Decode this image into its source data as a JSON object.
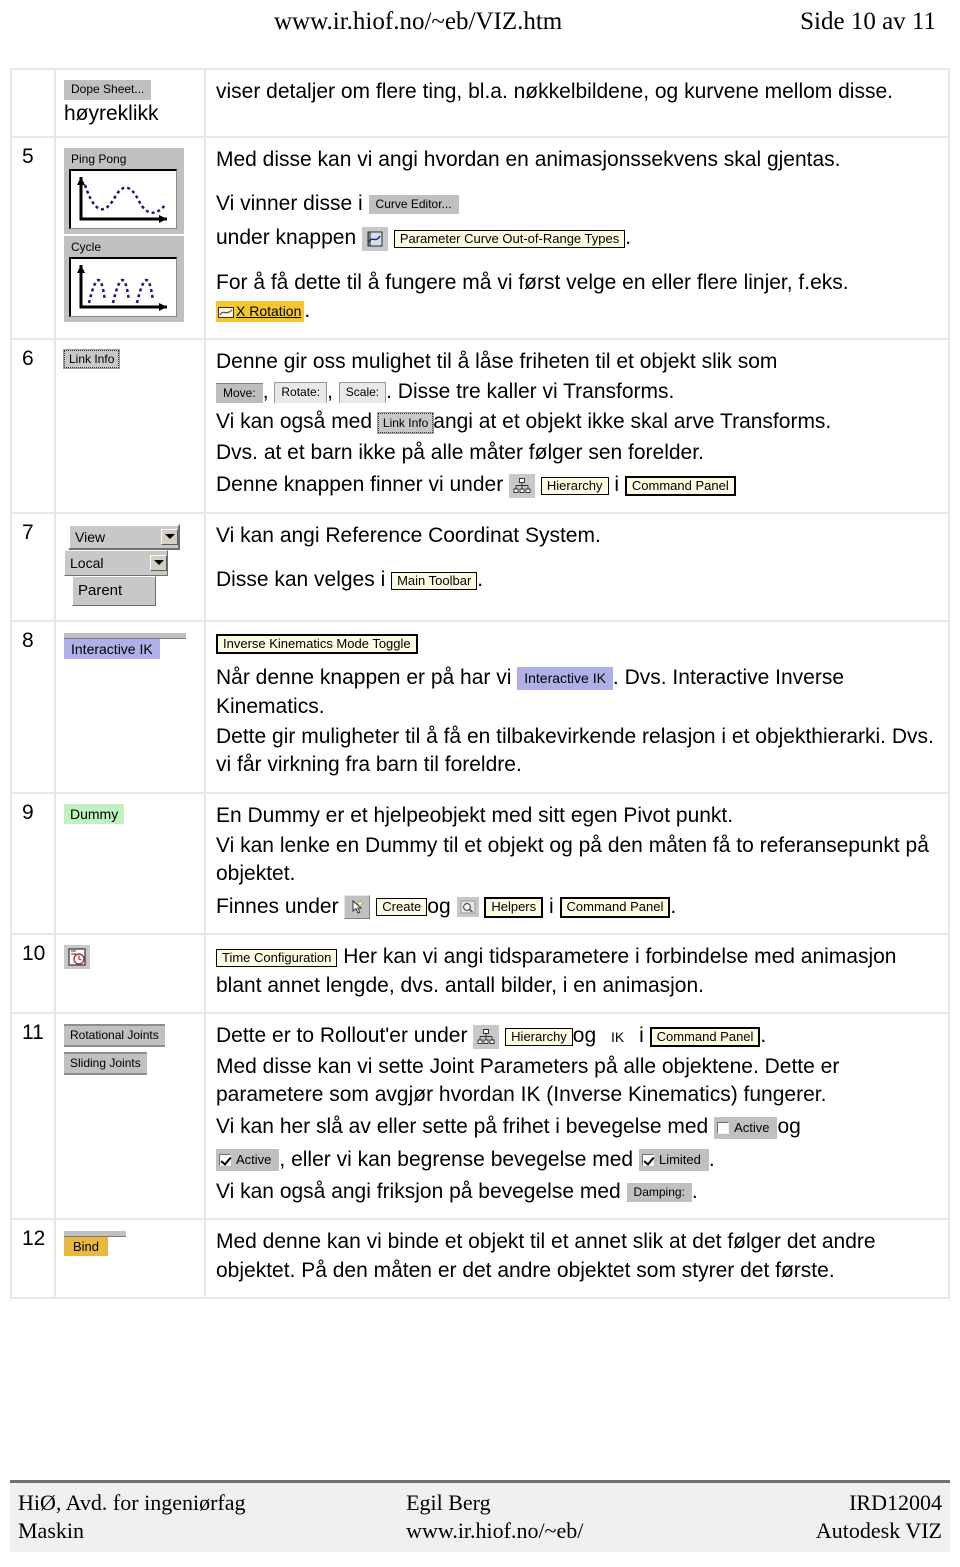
{
  "header": {
    "url": "www.ir.hiof.no/~eb/VIZ.htm",
    "page_label": "Side 10 av 11"
  },
  "rows": [
    {
      "num": "",
      "icon": {
        "button": "Dope Sheet...",
        "caption": "høyreklikk"
      },
      "paragraphs": [
        "viser detaljer om flere ting, bl.a. nøkkelbildene, og kurvene mellom disse."
      ]
    },
    {
      "num": "5",
      "icon": {
        "ping_pong": "Ping Pong",
        "cycle": "Cycle"
      },
      "text": {
        "p1": "Med disse kan vi angi hvordan en animasjonssekvens skal gjentas.",
        "p2_pre": "Vi vinner disse i",
        "curve_editor": "Curve Editor...",
        "p3_pre": "under knappen",
        "param_curve_tip": "Parameter Curve Out-of-Range Types",
        "p3_post": ".",
        "p4_pre": "For å få dette til å fungere må vi først velge en eller flere linjer, f.eks.",
        "x_rotation": "X Rotation",
        "p4_post": "."
      }
    },
    {
      "num": "6",
      "icon": {
        "link_info": "Link Info"
      },
      "text": {
        "p1": "Denne gir oss mulighet til å låse friheten til et objekt slik som",
        "move": "Move:",
        "rotate": "Rotate:",
        "scale": "Scale:",
        "p2_post": ". Disse tre kaller vi Transforms.",
        "p3_pre": "Vi kan også med",
        "link_info": "Link Info",
        "p3_post": "angi at et objekt ikke skal arve Transforms.",
        "p4": "Dvs. at et barn ikke på alle måter følger sen forelder.",
        "p5_pre": "Denne knappen finner vi under",
        "hierarchy": "Hierarchy",
        "sep": "i",
        "command_panel": "Command Panel"
      }
    },
    {
      "num": "7",
      "icon": {
        "view": "View",
        "local": "Local",
        "parent": "Parent"
      },
      "text": {
        "p1": "Vi kan angi Reference Coordinat System.",
        "p2_pre": "Disse kan velges i",
        "main_toolbar": "Main Toolbar",
        "p2_post": "."
      }
    },
    {
      "num": "8",
      "icon": {
        "interactive_ik": "Interactive IK"
      },
      "text": {
        "toggle_tip": "Inverse Kinematics Mode Toggle",
        "p1_pre": "Når denne knappen er på har vi",
        "interactive_ik": "Interactive IK",
        "p1_post": ". Dvs. Interactive Inverse Kinematics.",
        "p2": "Dette gir muligheter til å få en tilbakevirkende relasjon i et objekthierarki. Dvs. vi får virkning fra barn til foreldre."
      }
    },
    {
      "num": "9",
      "icon": {
        "dummy": "Dummy"
      },
      "text": {
        "p1": "En Dummy er et hjelpeobjekt med sitt egen Pivot punkt.",
        "p2": "Vi kan lenke en Dummy til et objekt og på den måten få to referansepunkt på objektet.",
        "p3_pre": "Finnes under",
        "create": "Create",
        "og": "og",
        "helpers": "Helpers",
        "sep": "i",
        "command_panel": "Command Panel",
        "p3_post": "."
      }
    },
    {
      "num": "10",
      "icon": {
        "time_config_icon": "time-configuration-icon"
      },
      "text": {
        "time_configuration": "Time Configuration",
        "p1": "Her kan vi angi tidsparametere i forbindelse med animasjon blant annet lengde, dvs. antall bilder, i en animasjon."
      }
    },
    {
      "num": "11",
      "icon": {
        "rotational_joints": "Rotational Joints",
        "sliding_joints": "Sliding Joints"
      },
      "text": {
        "p1_pre": "Dette er to Rollout'er under",
        "hierarchy": "Hierarchy",
        "og": "og",
        "ik": "IK",
        "sep": "i",
        "command_panel": "Command Panel",
        "p1_post": ".",
        "p2": "Med disse kan vi sette Joint Parameters på alle objektene. Dette er parametere som avgjør hvordan IK (Inverse Kinematics) fungerer.",
        "p3_pre": "Vi kan her slå av eller sette på frihet i bevegelse med",
        "active_unchecked": "Active",
        "p3_mid": "og",
        "active_checked": "Active",
        "p4_mid": ", eller vi kan begrense bevegelse med",
        "limited_checked": "Limited",
        "p4_post": ".",
        "p5_pre": "Vi kan også angi friksjon på bevegelse med",
        "damping": "Damping:",
        "p5_post": "."
      }
    },
    {
      "num": "12",
      "icon": {
        "bind": "Bind"
      },
      "text": {
        "p1": "Med denne kan vi binde et objekt til et annet slik at det følger det andre objektet. På den måten er det andre objektet som styrer det første."
      }
    }
  ],
  "footer": {
    "left_line1": "HiØ, Avd. for ingeniørfag",
    "left_line2": "Maskin",
    "center_line1": "Egil Berg",
    "center_line2": "www.ir.hiof.no/~eb/",
    "right_line1": "IRD12004",
    "right_line2": "Autodesk VIZ"
  },
  "colors": {
    "widget_gray": "#c0c0c0",
    "tooltip_yellow": "#fdfbe2",
    "highlight_yellow": "#f5c632",
    "highlight_blue": "#b0b0e8",
    "highlight_green": "#bff2bf",
    "bind_gold": "#e8b93d"
  }
}
